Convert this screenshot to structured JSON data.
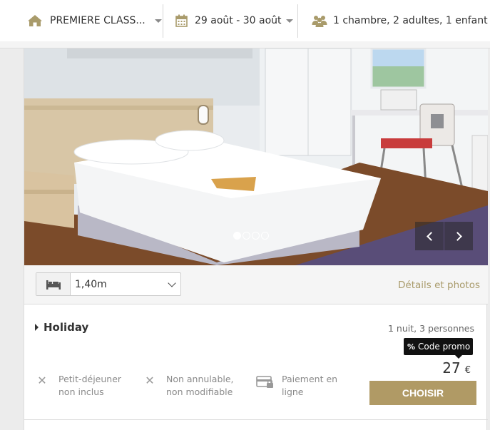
{
  "header": {
    "hotel_label": "PREMIERE CLASS...",
    "dates_label": "29 août - 30 août",
    "guests_label": "1 chambre, 2 adultes, 1 enfant",
    "icons": {
      "hotel": "home-icon",
      "dates": "calendar-icon",
      "guests": "people-icon"
    }
  },
  "room": {
    "carousel": {
      "dot_count": 4,
      "active_dot": 1
    },
    "bed_size": "1,40m",
    "details_link": "Détails et photos"
  },
  "rate": {
    "name": "Holiday",
    "stay_summary": "1 nuit, 3 personnes",
    "promo_label": "Code promo",
    "price": "27",
    "currency": "€",
    "features": [
      {
        "icon": "x-icon",
        "text": "Petit-déjeuner non inclus"
      },
      {
        "icon": "x-icon",
        "text": "Non annulable, non modifiable"
      },
      {
        "icon": "card-lock-icon",
        "text": "Paiement en ligne"
      }
    ],
    "choose_label": "CHOISIR"
  },
  "colors": {
    "accent": "#b09a65",
    "icon_gold": "#a99b6b",
    "promo_bg": "#111111"
  }
}
